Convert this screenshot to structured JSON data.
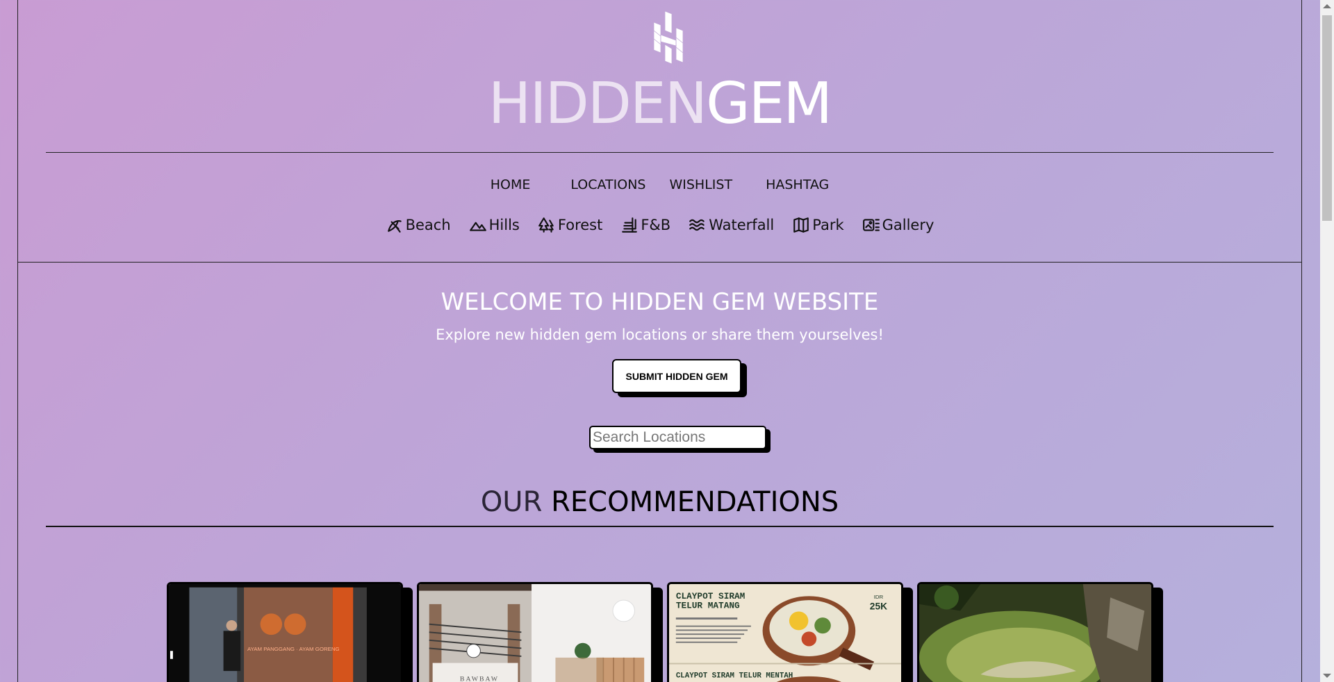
{
  "brand": {
    "part1": "HIDDEN",
    "part2": "GEM",
    "logo_icon": "hidden-gem-logo"
  },
  "nav": {
    "items": [
      {
        "label": "HOME"
      },
      {
        "label": "LOCATIONS"
      },
      {
        "label": "WISHLIST"
      },
      {
        "label": "HASHTAG"
      }
    ]
  },
  "categories": [
    {
      "label": "Beach",
      "icon": "beach-umbrella-icon"
    },
    {
      "label": "Hills",
      "icon": "mountain-icon"
    },
    {
      "label": "Forest",
      "icon": "trees-icon"
    },
    {
      "label": "F&B",
      "icon": "food-tray-icon"
    },
    {
      "label": "Waterfall",
      "icon": "waves-icon"
    },
    {
      "label": "Park",
      "icon": "map-icon"
    },
    {
      "label": "Gallery",
      "icon": "gallery-icon"
    }
  ],
  "hero": {
    "title": "WELCOME TO HIDDEN GEM WEBSITE",
    "subtitle": "Explore new hidden gem locations or share them yourselves!",
    "submit_label": "SUBMIT HIDDEN GEM",
    "search_placeholder": "Search Locations"
  },
  "recommendations": {
    "title_part1": "OUR",
    "title_part2": " RECOMMENDATIONS",
    "cards": [
      {
        "caption": "AYAM PANGGANG · AYAM GORENG"
      },
      {
        "caption": "BAWBAW"
      },
      {
        "caption_line1": "CLAYPOT SIRAM",
        "caption_line2": "TELUR MATANG",
        "price": "25K",
        "price_prefix": "IDR",
        "caption2": "CLAYPOT SIRAM TELUR MENTAH"
      },
      {
        "caption": ""
      }
    ]
  },
  "colors": {
    "bg_start": "#c99cd3",
    "bg_end": "#b5b0dc",
    "shadow": "#000000",
    "text_light": "#ffffff"
  }
}
